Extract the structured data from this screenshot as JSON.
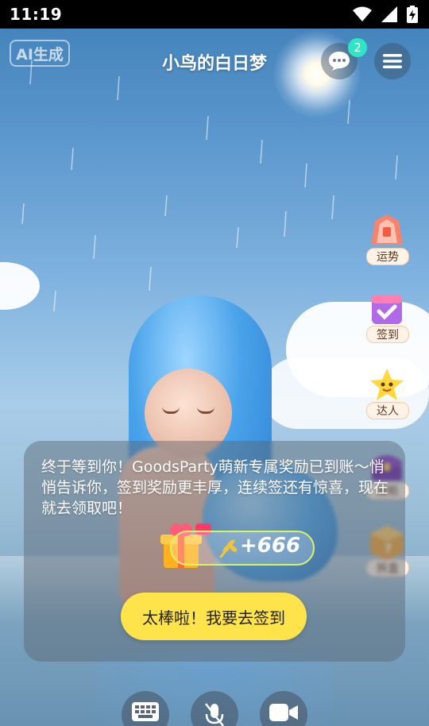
{
  "status_bar": {
    "time": "11:19",
    "icons": [
      "wifi-icon",
      "signal-icon",
      "battery-charging-icon"
    ]
  },
  "header": {
    "ai_badge": "AI生成",
    "title": "小鸟的白日梦",
    "message_count": "2",
    "icons": [
      "chat-icon",
      "menu-icon"
    ]
  },
  "side_actions": [
    {
      "label": "运势",
      "icon": "fortune-icon"
    },
    {
      "label": "签到",
      "icon": "calendar-check-icon"
    },
    {
      "label": "达人",
      "icon": "star-face-icon"
    },
    {
      "label": "展柜",
      "icon": "treasure-chest-icon"
    },
    {
      "label": "拆盒",
      "icon": "mystery-box-icon"
    }
  ],
  "reward_dialog": {
    "message": "终于等到你！GoodsParty萌新专属奖励已到账～悄悄告诉你，签到奖励更丰厚，连续签还有惊喜，现在就去领取吧！",
    "gift_icon": "gift-box-icon",
    "currency_icon": "wheat-icon",
    "amount": "+666",
    "cta_label": "太棒啦！我要去签到"
  },
  "bottom_toolbar": [
    "keyboard-icon",
    "microphone-off-icon",
    "video-camera-icon"
  ],
  "colors": {
    "accent_yellow": "#ffe34a",
    "badge_teal": "#2ee6c5",
    "pill_border": "#d9f26a"
  }
}
